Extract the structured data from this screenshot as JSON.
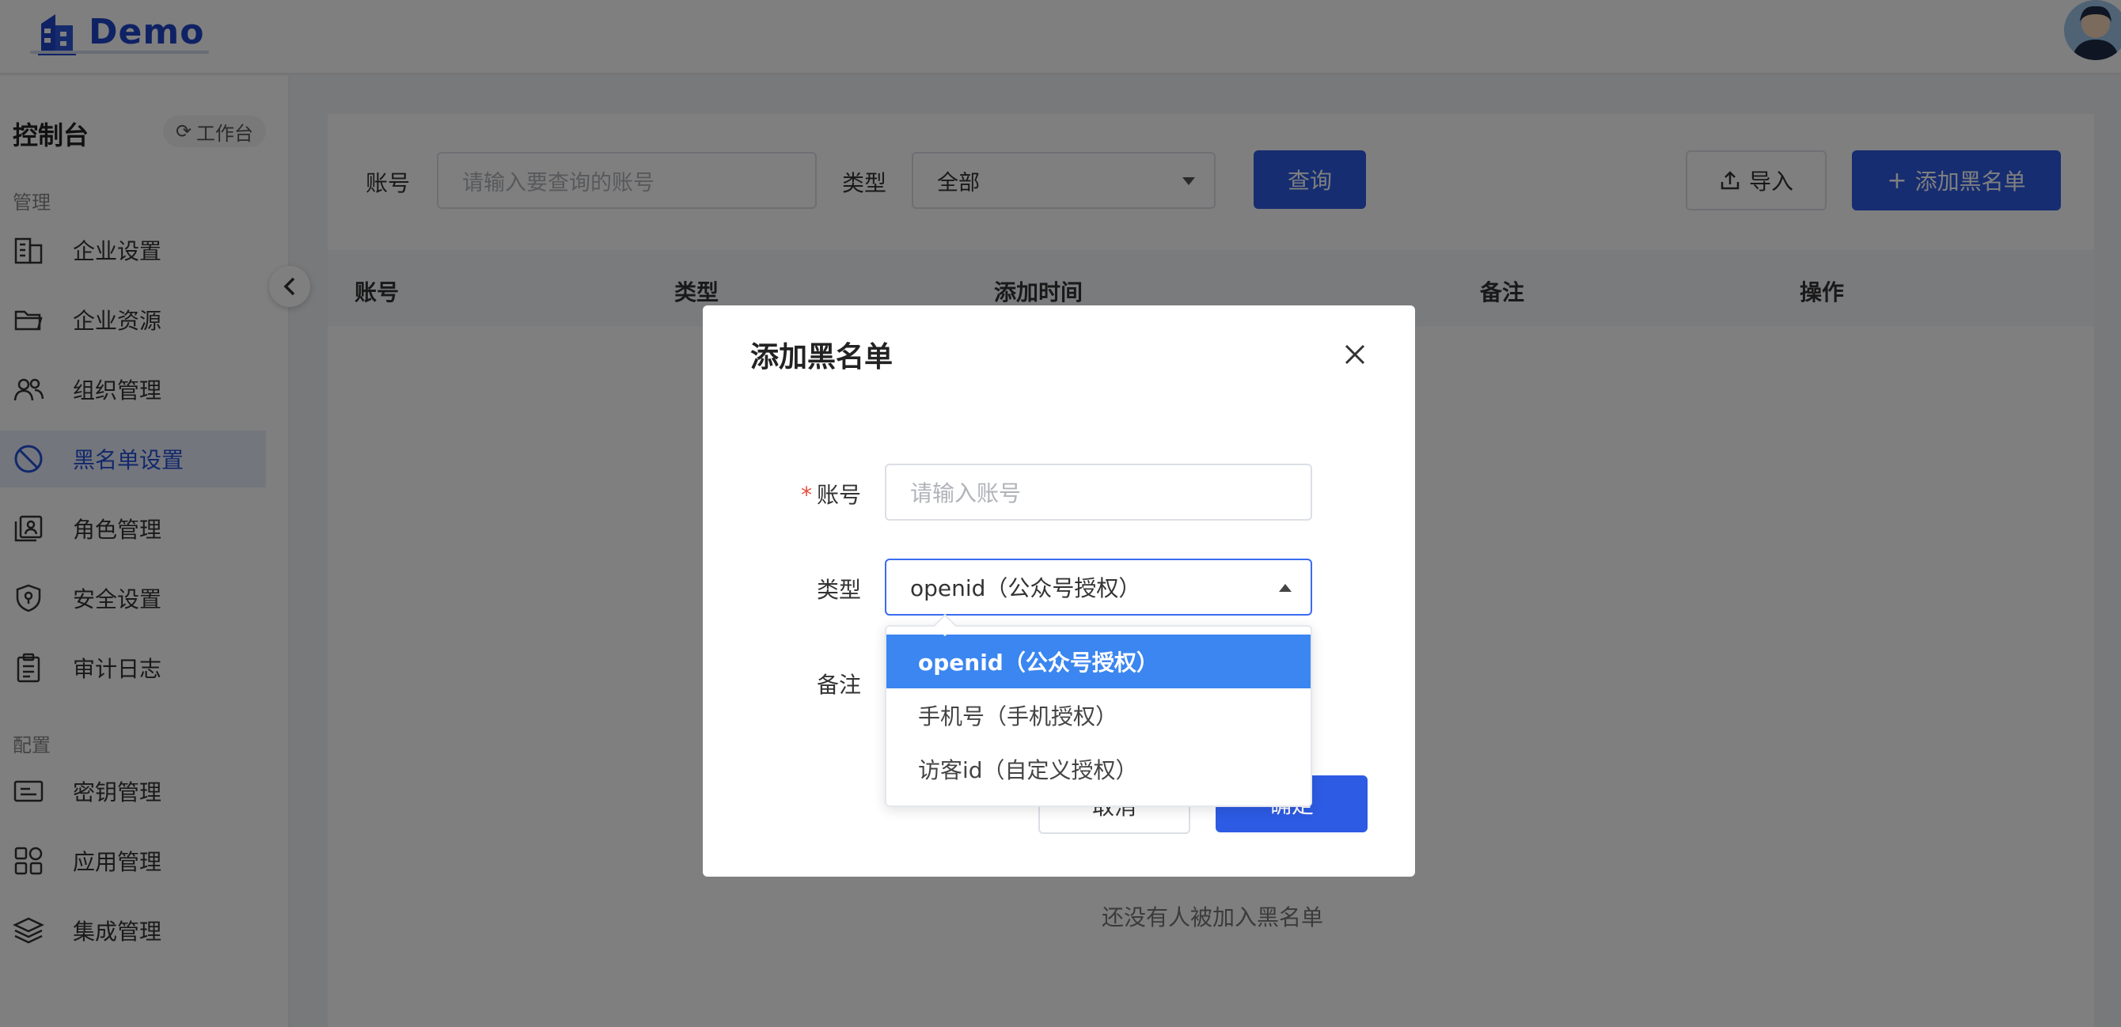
{
  "app": {
    "logo_text": "Demo"
  },
  "sidebar": {
    "title": "控制台",
    "workbench_label": "工作台",
    "section_manage": "管理",
    "section_config": "配置",
    "manage_items": [
      {
        "label": "企业设置",
        "icon": "building-icon"
      },
      {
        "label": "企业资源",
        "icon": "folder-icon"
      },
      {
        "label": "组织管理",
        "icon": "users-icon"
      },
      {
        "label": "黑名单设置",
        "icon": "ban-icon",
        "active": true
      },
      {
        "label": "角色管理",
        "icon": "role-icon"
      },
      {
        "label": "安全设置",
        "icon": "shield-icon"
      },
      {
        "label": "审计日志",
        "icon": "clipboard-icon"
      }
    ],
    "config_items": [
      {
        "label": "密钥管理",
        "icon": "key-card-icon"
      },
      {
        "label": "应用管理",
        "icon": "apps-icon"
      },
      {
        "label": "集成管理",
        "icon": "layers-icon"
      }
    ]
  },
  "filters": {
    "account_label": "账号",
    "account_placeholder": "请输入要查询的账号",
    "type_label": "类型",
    "type_value": "全部",
    "query_button": "查询",
    "import_button": "导入",
    "add_button": "添加黑名单"
  },
  "table": {
    "columns": [
      "账号",
      "类型",
      "添加时间",
      "备注",
      "操作"
    ],
    "empty_text": "还没有人被加入黑名单"
  },
  "modal": {
    "title": "添加黑名单",
    "account_label": "账号",
    "account_placeholder": "请输入账号",
    "type_label": "类型",
    "type_value": "openid（公众号授权）",
    "remark_label": "备注",
    "cancel_button": "取消",
    "ok_button": "确定",
    "type_options": [
      "openid（公众号授权）",
      "手机号（手机授权）",
      "访客id（自定义授权）"
    ]
  },
  "colors": {
    "primary": "#2d5be3",
    "active_option": "#3b86f0",
    "required": "#e34d3d"
  }
}
